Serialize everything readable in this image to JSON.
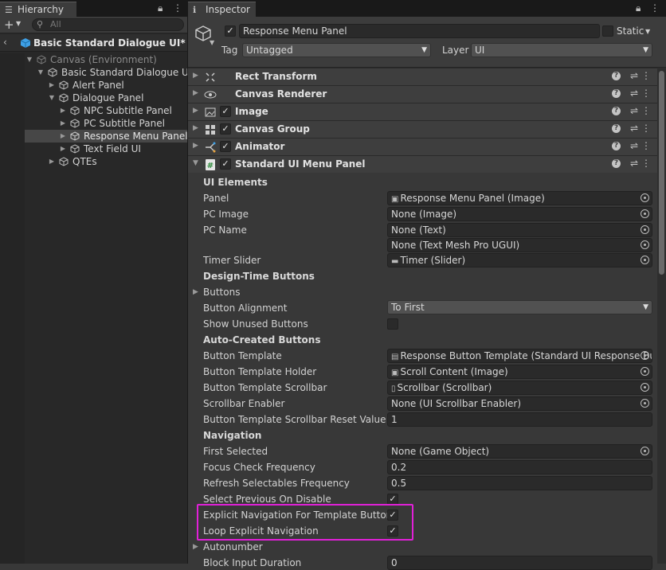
{
  "hierarchy": {
    "tab_title": "Hierarchy",
    "search_placeholder": "All",
    "scene_name": "Basic Standard Dialogue UI*",
    "items": [
      {
        "label": "Canvas (Environment)"
      },
      {
        "label": "Basic Standard Dialogue UI"
      },
      {
        "label": "Alert Panel"
      },
      {
        "label": "Dialogue Panel"
      },
      {
        "label": "NPC Subtitle Panel"
      },
      {
        "label": "PC Subtitle Panel"
      },
      {
        "label": "Response Menu Panel"
      },
      {
        "label": "Text Field UI"
      },
      {
        "label": "QTEs"
      }
    ]
  },
  "inspector": {
    "tab_title": "Inspector",
    "object_name": "Response Menu Panel",
    "static_label": "Static",
    "tag_label": "Tag",
    "tag_value": "Untagged",
    "layer_label": "Layer",
    "layer_value": "UI",
    "components": [
      {
        "name": "Rect Transform"
      },
      {
        "name": "Canvas Renderer"
      },
      {
        "name": "Image"
      },
      {
        "name": "Canvas Group"
      },
      {
        "name": "Animator"
      },
      {
        "name": "Standard UI Menu Panel"
      }
    ],
    "props": {
      "ui_elements": "UI Elements",
      "panel_label": "Panel",
      "panel_value": "Response Menu Panel (Image)",
      "pc_image_label": "PC Image",
      "pc_image_value": "None (Image)",
      "pc_name_label": "PC Name",
      "pc_name_value1": "None (Text)",
      "pc_name_value2": "None (Text Mesh Pro UGUI)",
      "timer_slider_label": "Timer Slider",
      "timer_slider_value": "Timer (Slider)",
      "design_time_buttons": "Design-Time Buttons",
      "buttons_label": "Buttons",
      "button_alignment_label": "Button Alignment",
      "button_alignment_value": "To First",
      "show_unused_label": "Show Unused Buttons",
      "auto_created_buttons": "Auto-Created Buttons",
      "button_template_label": "Button Template",
      "button_template_value": "Response Button Template (Standard UI Response Bu",
      "button_template_holder_label": "Button Template Holder",
      "button_template_holder_value": "Scroll Content (Image)",
      "button_template_scrollbar_label": "Button Template Scrollbar",
      "button_template_scrollbar_value": "Scrollbar (Scrollbar)",
      "scrollbar_enabler_label": "Scrollbar Enabler",
      "scrollbar_enabler_value": "None (UI Scrollbar Enabler)",
      "scrollbar_reset_label": "Button Template Scrollbar Reset Value",
      "scrollbar_reset_value": "1",
      "navigation": "Navigation",
      "first_selected_label": "First Selected",
      "first_selected_value": "None (Game Object)",
      "focus_check_label": "Focus Check Frequency",
      "focus_check_value": "0.2",
      "refresh_selectables_label": "Refresh Selectables Frequency",
      "refresh_selectables_value": "0.5",
      "select_previous_label": "Select Previous On Disable",
      "explicit_nav_label": "Explicit Navigation For Template Buttons",
      "loop_explicit_label": "Loop Explicit Navigation",
      "autonumber_label": "Autonumber",
      "block_input_label": "Block Input Duration",
      "block_input_value": "0"
    }
  },
  "colors": {
    "highlight": "#e120d8",
    "cube_blue": "#3fa0e6"
  }
}
